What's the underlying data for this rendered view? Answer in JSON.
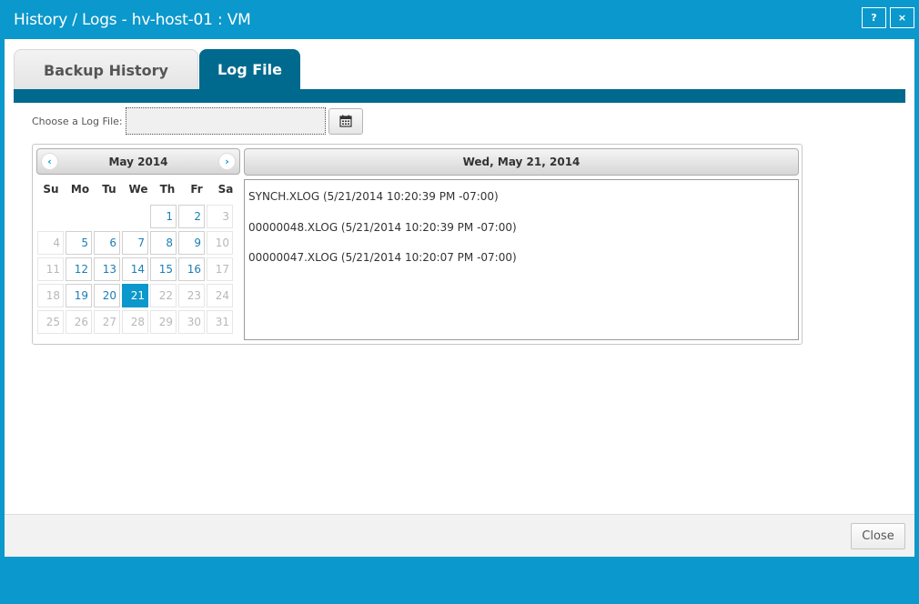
{
  "window": {
    "title": "History / Logs - hv-host-01 : VM",
    "help_label": "?",
    "close_label": "×"
  },
  "tabs": [
    {
      "label": "Backup History",
      "active": false
    },
    {
      "label": "Log File",
      "active": true
    }
  ],
  "chooser": {
    "label": "Choose a Log File:",
    "value": "",
    "icon": "calendar-icon"
  },
  "calendar": {
    "month_label": "May 2014",
    "prev_label": "‹",
    "next_label": "›",
    "weekdays": [
      "Su",
      "Mo",
      "Tu",
      "We",
      "Th",
      "Fr",
      "Sa"
    ],
    "days": [
      {
        "label": "",
        "state": "blank"
      },
      {
        "label": "",
        "state": "blank"
      },
      {
        "label": "",
        "state": "blank"
      },
      {
        "label": "",
        "state": "blank"
      },
      {
        "label": "1",
        "state": "active"
      },
      {
        "label": "2",
        "state": "active"
      },
      {
        "label": "3",
        "state": "off"
      },
      {
        "label": "4",
        "state": "off"
      },
      {
        "label": "5",
        "state": "active"
      },
      {
        "label": "6",
        "state": "active"
      },
      {
        "label": "7",
        "state": "active"
      },
      {
        "label": "8",
        "state": "active"
      },
      {
        "label": "9",
        "state": "active"
      },
      {
        "label": "10",
        "state": "off"
      },
      {
        "label": "11",
        "state": "off"
      },
      {
        "label": "12",
        "state": "active"
      },
      {
        "label": "13",
        "state": "active"
      },
      {
        "label": "14",
        "state": "active"
      },
      {
        "label": "15",
        "state": "active"
      },
      {
        "label": "16",
        "state": "active"
      },
      {
        "label": "17",
        "state": "off"
      },
      {
        "label": "18",
        "state": "off"
      },
      {
        "label": "19",
        "state": "active"
      },
      {
        "label": "20",
        "state": "active"
      },
      {
        "label": "21",
        "state": "selected"
      },
      {
        "label": "22",
        "state": "off"
      },
      {
        "label": "23",
        "state": "off"
      },
      {
        "label": "24",
        "state": "off"
      },
      {
        "label": "25",
        "state": "off"
      },
      {
        "label": "26",
        "state": "off"
      },
      {
        "label": "27",
        "state": "off"
      },
      {
        "label": "28",
        "state": "off"
      },
      {
        "label": "29",
        "state": "off"
      },
      {
        "label": "30",
        "state": "off"
      },
      {
        "label": "31",
        "state": "off"
      }
    ]
  },
  "log_panel": {
    "date_header": "Wed, May 21, 2014",
    "items": [
      "SYNCH.XLOG (5/21/2014 10:20:39 PM -07:00)",
      "00000048.XLOG (5/21/2014 10:20:39 PM -07:00)",
      "00000047.XLOG (5/21/2014 10:20:07 PM -07:00)"
    ]
  },
  "footer": {
    "close_label": "Close"
  },
  "colors": {
    "accent": "#0b98cc",
    "tab_active": "#006a8e"
  }
}
